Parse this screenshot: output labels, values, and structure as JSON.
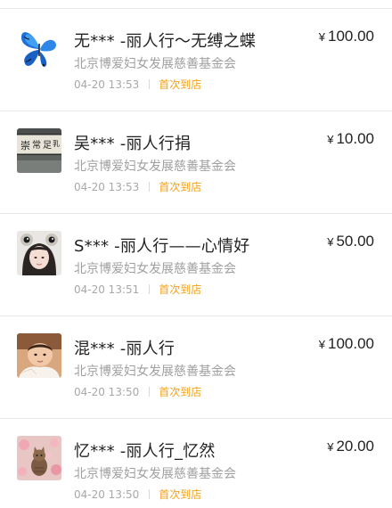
{
  "donations": [
    {
      "title": "无*** -丽人行～无缚之蝶",
      "org": "北京博爱妇女发展慈善基金会",
      "time": "04-20 13:53",
      "tag": "首次到店",
      "currency": "¥",
      "amount": "100.00",
      "avatar_icon": "butterfly-avatar-icon"
    },
    {
      "title": "吴*** -丽人行捐",
      "org": "北京博爱妇女发展慈善基金会",
      "time": "04-20 13:53",
      "tag": "首次到店",
      "currency": "¥",
      "amount": "10.00",
      "avatar_icon": "calligraphy-avatar-icon"
    },
    {
      "title": "S*** -丽人行——心情好",
      "org": "北京博爱妇女发展慈善基金会",
      "time": "04-20 13:51",
      "tag": "首次到店",
      "currency": "¥",
      "amount": "50.00",
      "avatar_icon": "girl-with-frog-hat-avatar-icon"
    },
    {
      "title": "混*** -丽人行",
      "org": "北京博爱妇女发展慈善基金会",
      "time": "04-20 13:50",
      "tag": "首次到店",
      "currency": "¥",
      "amount": "100.00",
      "avatar_icon": "baby-avatar-icon"
    },
    {
      "title": "忆*** -丽人行_忆然",
      "org": "北京博爱妇女发展慈善基金会",
      "time": "04-20 13:50",
      "tag": "首次到店",
      "currency": "¥",
      "amount": "20.00",
      "avatar_icon": "cat-in-flowers-avatar-icon"
    }
  ],
  "colors": {
    "tag": "#f3a11a",
    "title": "#222222",
    "org": "#a0a0a0",
    "divider": "#e6e6e6"
  }
}
